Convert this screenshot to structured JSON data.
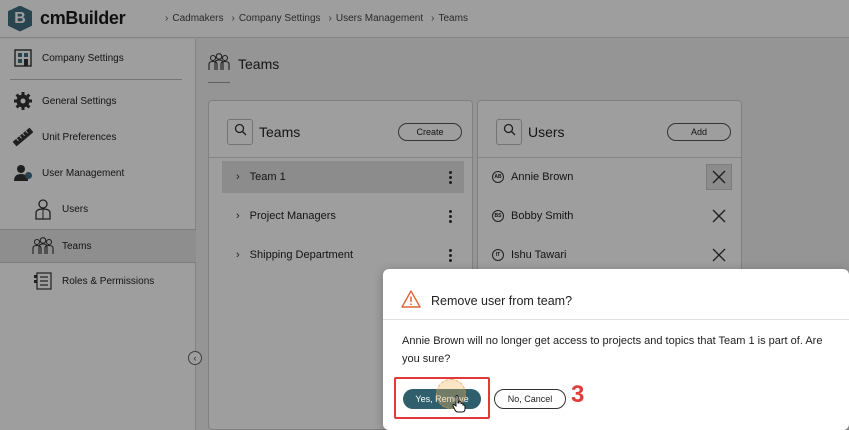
{
  "app": {
    "name": "cmBuilder",
    "logo_letter": "B"
  },
  "breadcrumbs": [
    "Cadmakers",
    "Company Settings",
    "Users Management",
    "Teams"
  ],
  "sidebar": {
    "header": "Company Settings",
    "items": [
      {
        "label": "General Settings",
        "icon": "gear-icon"
      },
      {
        "label": "Unit Preferences",
        "icon": "ruler-icon"
      },
      {
        "label": "User Management",
        "icon": "user-management-icon"
      },
      {
        "label": "Users",
        "icon": "user-icon"
      },
      {
        "label": "Teams",
        "icon": "team-icon",
        "active": true
      },
      {
        "label": "Roles & Permissions",
        "icon": "roles-icon"
      }
    ]
  },
  "page": {
    "title": "Teams"
  },
  "teams_panel": {
    "title": "Teams",
    "create_label": "Create",
    "rows": [
      {
        "label": "Team 1",
        "selected": true
      },
      {
        "label": "Project Managers"
      },
      {
        "label": "Shipping Department"
      }
    ]
  },
  "users_panel": {
    "title": "Users",
    "add_label": "Add",
    "rows": [
      {
        "initials": "AB",
        "name": "Annie Brown"
      },
      {
        "initials": "BS",
        "name": "Bobby Smith"
      },
      {
        "initials": "IT",
        "name": "Ishu Tawari"
      }
    ]
  },
  "modal": {
    "title": "Remove user from team?",
    "message": "Annie Brown will no longer get access to projects and topics that Team 1 is part of. Are you sure?",
    "confirm_label": "Yes, Remove",
    "cancel_label": "No, Cancel"
  },
  "annotation": {
    "step_number": "3",
    "color": "#e23a3a"
  },
  "colors": {
    "primary": "#2f5f6d",
    "brand": "#3f6f80"
  }
}
